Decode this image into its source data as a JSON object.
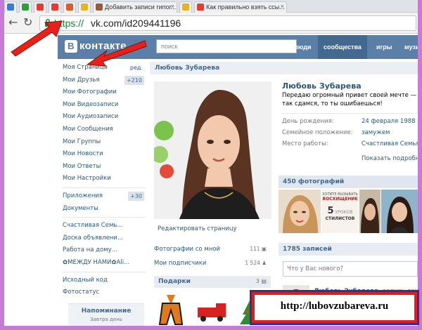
{
  "browser": {
    "tabs": [
      {
        "label": "",
        "color": "#3b7bd6"
      },
      {
        "label": "",
        "color": "#2e9e3b"
      },
      {
        "label": "",
        "color": "#e63c2e"
      },
      {
        "label": "",
        "color": "#e63c2e"
      },
      {
        "label": "",
        "color": "#e05a2a"
      },
      {
        "label": "",
        "color": "#e6b620"
      },
      {
        "label": "Добавить записи гипог...",
        "color": "#9a5b3a"
      },
      {
        "label": "",
        "color": "#e6b620"
      },
      {
        "label": "Как правильно взять ссы...",
        "color": "#e63c2e"
      }
    ],
    "url_scheme": "https://",
    "url_host": "vk.com/id209441196"
  },
  "vk": {
    "logo": "контакте",
    "logo_letter": "B",
    "search_placeholder": "поиск",
    "nav": [
      "люди",
      "сообщества",
      "игры",
      "музы"
    ],
    "nav_active_index": 1
  },
  "left_menu": {
    "group1": [
      {
        "label": "Моя Страница",
        "extra": "ред."
      },
      {
        "label": "Мои Друзья",
        "badge": "+210"
      },
      {
        "label": "Мои Фотографии"
      },
      {
        "label": "Мои Видеозаписи"
      },
      {
        "label": "Мои Аудиозаписи"
      },
      {
        "label": "Мои Сообщения"
      },
      {
        "label": "Мои Группы"
      },
      {
        "label": "Мои Новости"
      },
      {
        "label": "Мои Ответы"
      },
      {
        "label": "Мои Настройки"
      }
    ],
    "group2": [
      {
        "label": "Приложения",
        "badge": "+30"
      },
      {
        "label": "Документы"
      }
    ],
    "group3": [
      {
        "label": "Счастливая Семь..."
      },
      {
        "label": "Доска объявлени..."
      },
      {
        "label": "Работа на дому..."
      },
      {
        "label": "✿МЕЖДУ НАМИ✿Ali..."
      }
    ],
    "group4": [
      {
        "label": "Исходный код"
      },
      {
        "label": "Фотостатус"
      }
    ],
    "reminder_title": "Напоминание",
    "reminder_sub": "Завтра день"
  },
  "profile": {
    "header_name": "Любовь Зубарева",
    "name": "Любовь Зубарева",
    "status_line1": "Передаю огромный привет своей мечте —",
    "status_line2": "так сдамся, то ты ошибаешься!",
    "info": [
      {
        "label": "День рождения:",
        "value": "24 февраля 1988 г."
      },
      {
        "label": "Семейное положение:",
        "value": "замужем"
      },
      {
        "label": "Место работы:",
        "value": "Счастливая Семья."
      }
    ],
    "show_more": "Показать подробну",
    "edit_page": "Редактировать страницу",
    "photos_with_me": "Фотографии со мной",
    "photos_with_me_count": "111",
    "subscribers": "Мои подписчики",
    "subscribers_count": "1 524",
    "gifts_title": "Подарки",
    "gifts_count": "3",
    "photos_title": "450 фотографий",
    "thumb_ad_line1": "ХОТИТЕ ВЫЗЫВАТЬ",
    "thumb_ad_line2": "ВОСХИЩЕНИЕ",
    "thumb_ad_num": "5",
    "thumb_ad_line3": "УРОКОВ",
    "thumb_ad_line4": "СТИЛИСТОВ",
    "posts_title": "1785 записей",
    "post_placeholder": "Что у Вас нового?",
    "post_author": "Любовь Зубарева",
    "post_author_sub": "запись закреп"
  },
  "watermark_url": "http://lubovzubareva.ru"
}
